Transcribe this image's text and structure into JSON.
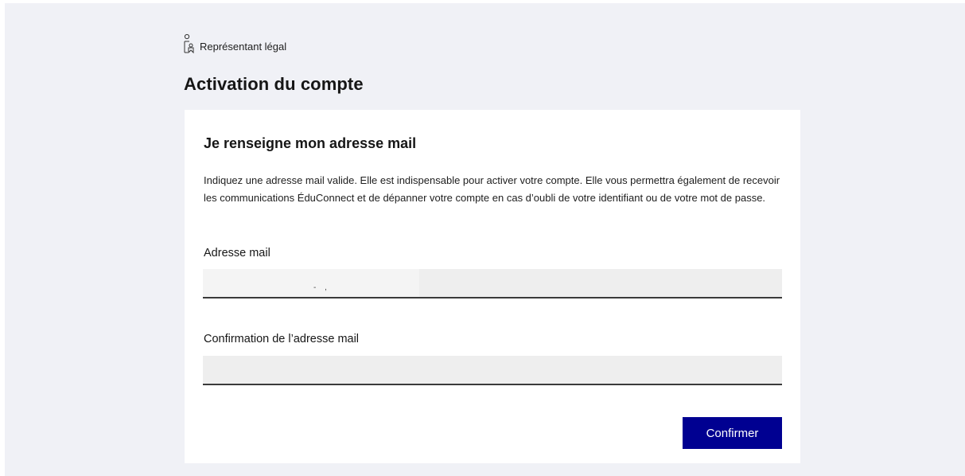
{
  "header": {
    "role_label": "Représentant légal",
    "role_icon": "person-pin-icon"
  },
  "page_title": "Activation du compte",
  "card": {
    "title": "Je renseigne mon adresse mail",
    "description": "Indiquez une adresse mail valide. Elle est indispensable pour activer votre compte. Elle vous permettra également de recevoir les communications ÉduConnect et de dépanner votre compte en cas d’oubli de votre identifiant ou de votre mot de passe.",
    "email_label": "Adresse mail",
    "email_value": "",
    "confirm_label": "Confirmation de l’adresse mail",
    "confirm_value": "",
    "submit_label": "Confirmer"
  },
  "colors": {
    "background": "#f0f1f6",
    "card": "#ffffff",
    "input_bg": "#eeeeee",
    "primary": "#000091"
  }
}
